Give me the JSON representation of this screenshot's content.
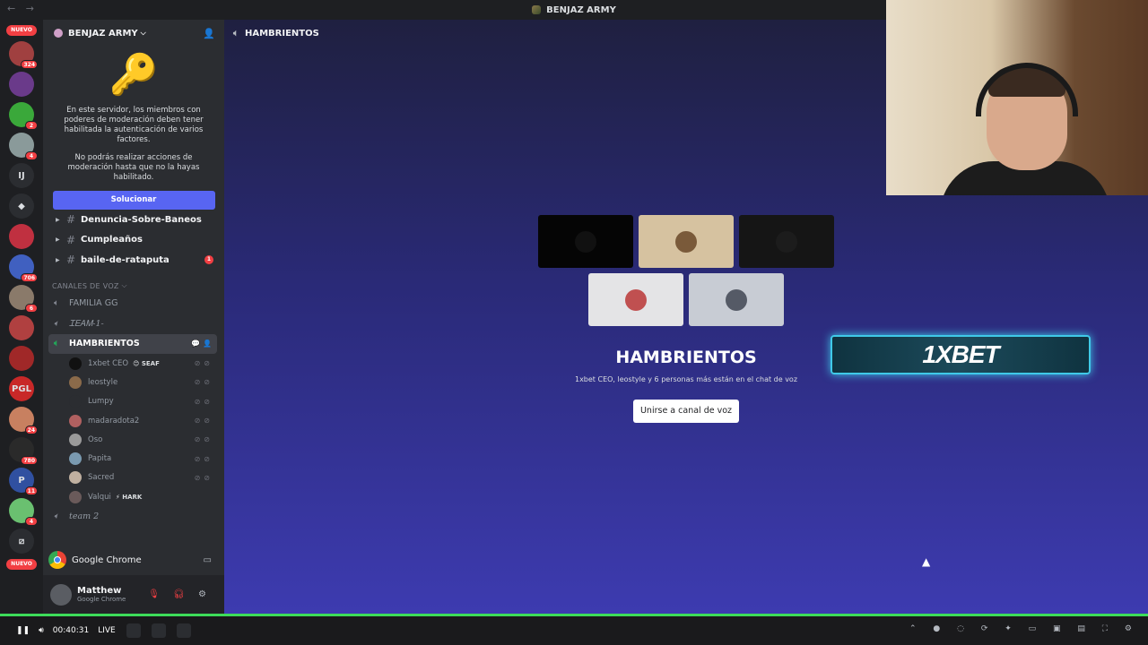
{
  "title_bar": {
    "nav": "← →",
    "title": "BENJAZ ARMY"
  },
  "rail": {
    "new_label": "NUEVO",
    "servers": [
      {
        "badge": "324",
        "color": "#a04040"
      },
      {
        "badge": "",
        "color": "#6a3a8a"
      },
      {
        "badge": "2",
        "color": "#3aa83a"
      },
      {
        "badge": "4",
        "color": "#8a9a9a"
      },
      {
        "text": "IJ"
      },
      {
        "text": "◆"
      },
      {
        "badge": "",
        "color": "#c03040"
      },
      {
        "badge": "706",
        "color": "#4060c0"
      },
      {
        "badge": "6",
        "color": "#8a7a6a"
      },
      {
        "badge": "",
        "color": "#b04040"
      },
      {
        "badge": "",
        "color": "#a02828"
      },
      {
        "text": "PGL",
        "color": "#c82828"
      },
      {
        "badge": "24",
        "color": "#c88060"
      },
      {
        "badge": "780",
        "color": "#2a2a2a"
      },
      {
        "badge": "11",
        "color": "#3050a0",
        "text": "P"
      },
      {
        "badge": "4",
        "color": "#6ac070"
      },
      {
        "text": "⧄"
      }
    ],
    "bottom_new_label": "NUEVO"
  },
  "sidebar": {
    "server_name": "BENJAZ ARMY",
    "mfa": {
      "line1": "En este servidor, los miembros con poderes de moderación deben tener habilitada la autenticación de varios factores.",
      "line2": "No podrás realizar acciones de moderación hasta que no la hayas habilitado.",
      "button": "Solucionar"
    },
    "text_channels": [
      {
        "name": "Denuncia-Sobre-Baneos",
        "badge": ""
      },
      {
        "name": "Cumpleaños",
        "badge": ""
      },
      {
        "name": "baile-de-rataputa",
        "badge": "1"
      }
    ],
    "voice_category": "CANALES DE VOZ",
    "voice_channels": {
      "familia": "FAMILIA GG",
      "team1": "ᏆᎬᎪᎷ-1-",
      "active": "HAMBRIENTOS",
      "team2": "team 2"
    },
    "members": [
      {
        "name": "1xbet CEO",
        "tag": "😊 SEAF",
        "color": "#111111"
      },
      {
        "name": "leostyle",
        "tag": "",
        "color": "#8a6a4a"
      },
      {
        "name": "Lumpy",
        "tag": "",
        "color": "#2b2d31"
      },
      {
        "name": "madaradota2",
        "tag": "",
        "color": "#b06060"
      },
      {
        "name": "Oso",
        "tag": "",
        "color": "#9a9a9a"
      },
      {
        "name": "Papita",
        "tag": "",
        "color": "#7a9ab0"
      },
      {
        "name": "Sacred",
        "tag": "",
        "color": "#c0b0a0"
      },
      {
        "name": "Valqui",
        "tag": "⚡ HARK",
        "color": "#6a5a5a"
      }
    ],
    "activity": "Google Chrome",
    "user": {
      "name": "Matthew",
      "status": "Google Chrome"
    }
  },
  "main": {
    "channel": "HAMBRIENTOS",
    "vc_title": "HAMBRIENTOS",
    "vc_subtitle": "1xbet CEO, leostyle y 6 personas más están en el chat de voz",
    "join_button": "Unirse a canal de voz",
    "ad_text": "1XBET"
  },
  "taskbar": {
    "timer": "00:40:31",
    "live": "LIVE"
  }
}
